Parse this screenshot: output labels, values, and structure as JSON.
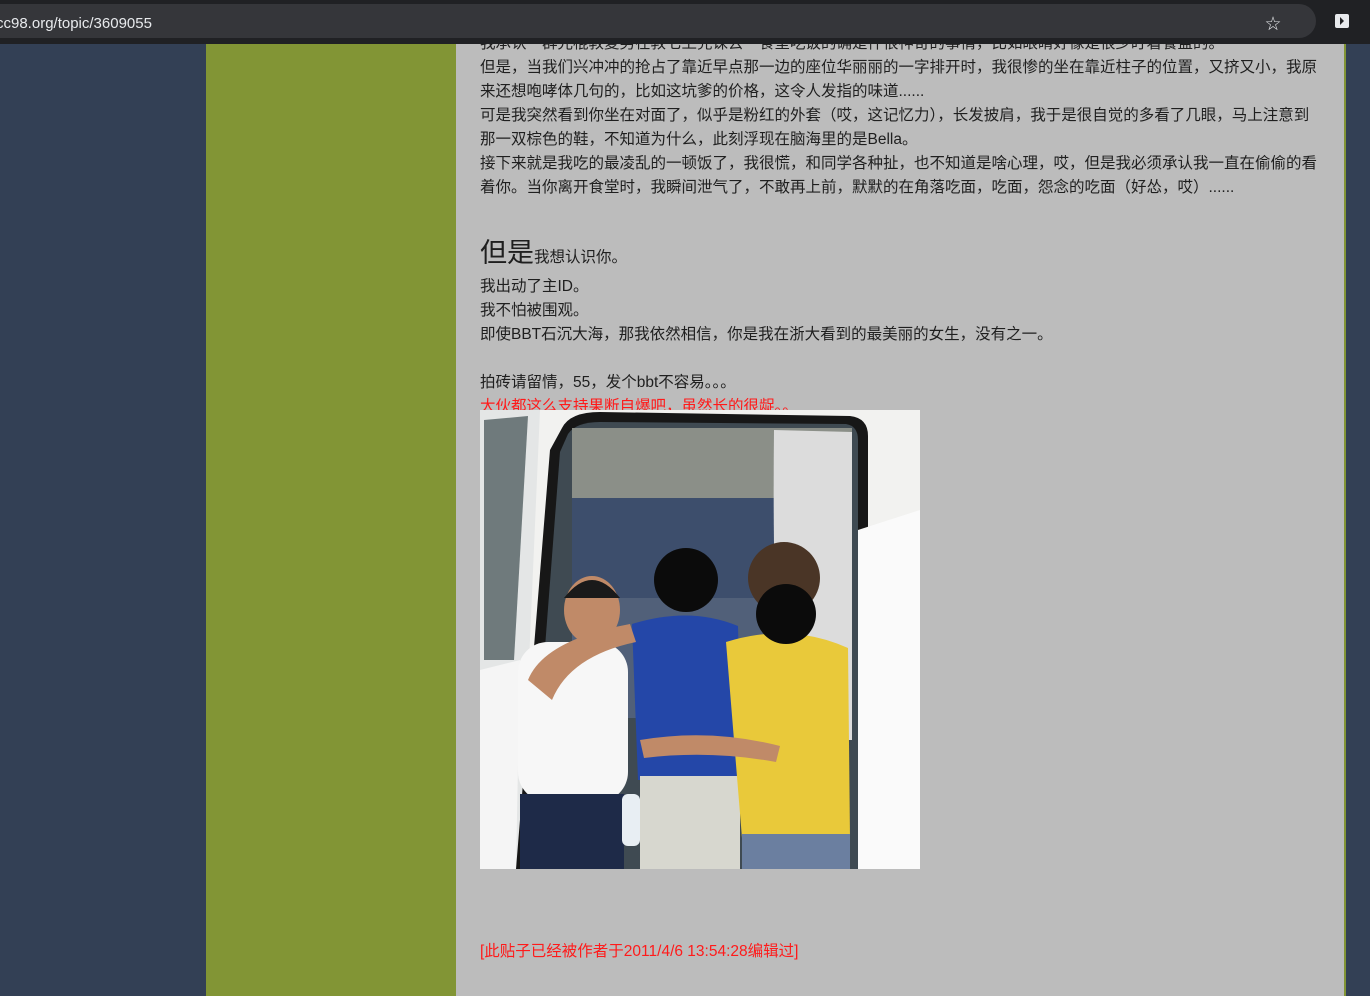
{
  "browser": {
    "url": "cc98.org/topic/3609055",
    "site_info_icon": "tune-icon",
    "bookmark_icon": "star-icon",
    "extension_icon": "extension-icon"
  },
  "colors": {
    "page_background": "#334055",
    "sidebar": "#829535",
    "post_background": "#bcbcbc",
    "red_text": "#ff1a1a"
  },
  "post": {
    "lines": [
      "我承认一群光棍教复男在教七上完课去一食堂吃饭的确是件很神奇的事情，比如眼睛好像是很少盯着餐盘的。",
      "但是，当我们兴冲冲的抢占了靠近早点那一边的座位华丽丽的一字排开时，我很惨的坐在靠近柱子的位置，又挤又小，我原来还想咆哮体几句的，比如这坑爹的价格，这令人发指的味道......",
      "可是我突然看到你坐在对面了，似乎是粉红的外套（哎，这记忆力），长发披肩，我于是很自觉的多看了几眼，马上注意到那一双棕色的鞋，不知道为什么，此刻浮现在脑海里的是Bella。",
      "接下来就是我吃的最凌乱的一顿饭了，我很慌，和同学各种扯，也不知道是啥心理，哎，但是我必须承认我一直在偷偷的看着你。当你离开食堂时，我瞬间泄气了，不敢再上前，默默的在角落吃面，吃面，怨念的吃面（好怂，哎）......"
    ],
    "big_word": "但是",
    "big_rest": "我想认识你。",
    "line_id": "我出动了主ID。",
    "line_fear": "我不怕被围观。",
    "line_bbt": "即使BBT石沉大海，那我依然相信，你是我在浙大看到的最美丽的女生，没有之一。",
    "line_brick": "拍砖请留情，55，发个bbt不容易。。。",
    "red_note": "大伙都这么支持果断自爆吧，虽然长的很龊。。",
    "edit_note": "[此贴子已经被作者于2011/4/6 13:54:28编辑过]"
  }
}
